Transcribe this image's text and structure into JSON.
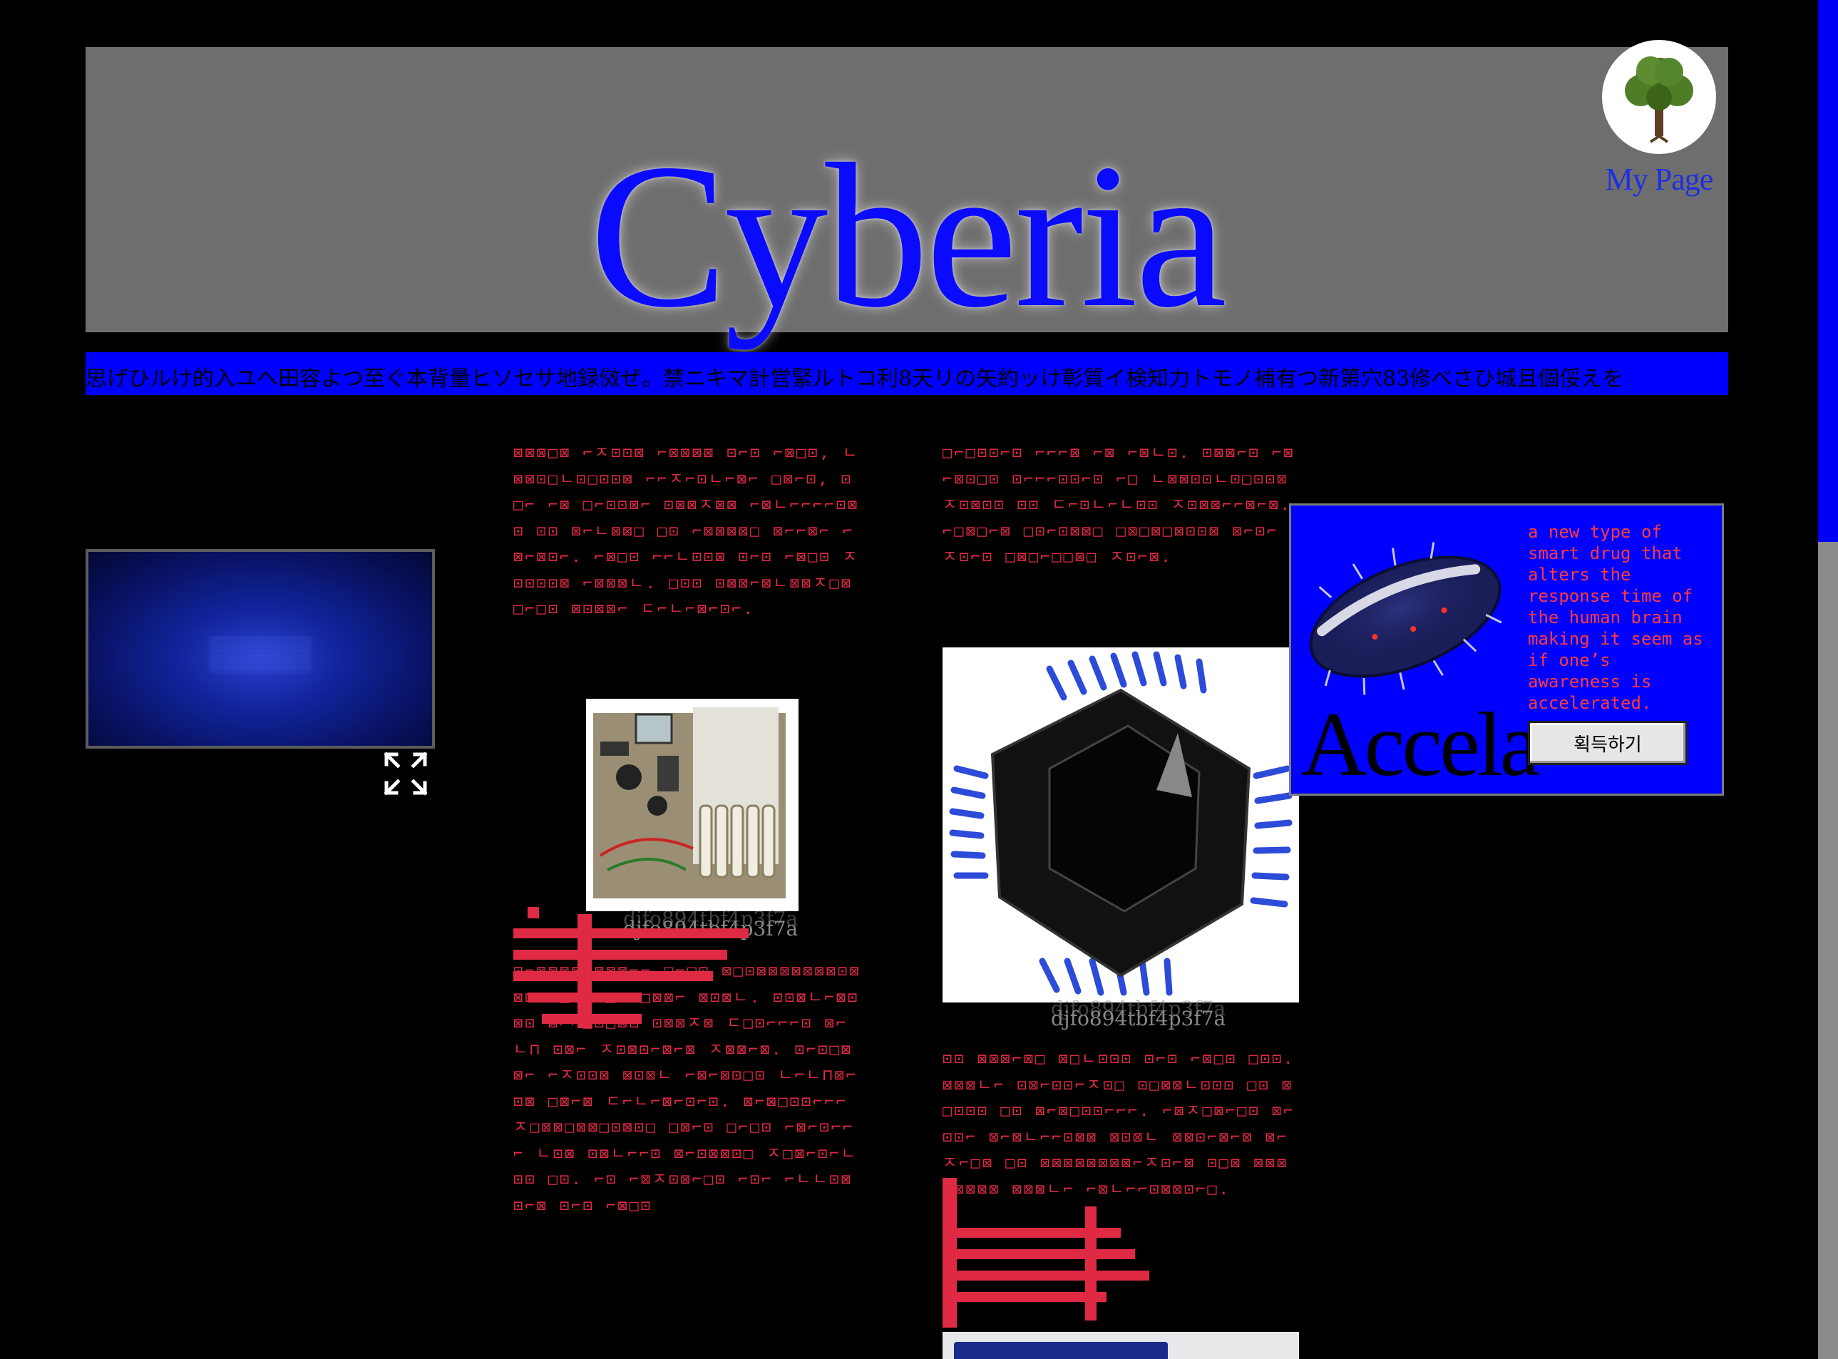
{
  "header": {
    "site_title": "Cyberia",
    "my_page_label": "My Page",
    "avatar_icon": "tree-icon"
  },
  "ticker": {
    "text": "思げひルけ的入ユヘ田容よつ至ぐ本背量ヒソセサ地録傚ぜ。禁ニキマ計営緊ルトコ利8天リの矢約ッけ彰質イ検知力トモノ補有つ新第穴83修べさひ城且個俀えを"
  },
  "video": {
    "fullscreen_icon": "fullscreen-icon"
  },
  "article": {
    "col_a_text": "⊠⊠⊠□⊠ ⌐ㅈ⊡⊡⊠ ⌐⊠⊠⊠⊠ ⊡⌐⊡ ⌐⊠□⊡, ㄴ⊠⊠⊡□ㄴ⊡□⊡⊡⊠ ⌐⌐ㅈ⌐⊡ㄴ⌐⊠⌐ □⊠⌐⊡, ⊡□⌐ ⌐⊠ □⌐⊡⊡⊠⌐ ⊡⊠⊠ㅈ⊠⊠ ⌐⊠ㄴ⌐⌐⌐⌐⊡⊠⊡ ⊡⊡ ⊠⌐ㄴ⊠⊠□ □⊡ ⌐⊠⊠⊠⊠□ ⊠⌐⌐⊠⌐ ⌐⊠⌐⊠⊡⌐. ⌐⊠□⊡ ⌐⌐ㄴ⊡⊡⊠ ⊡⌐⊡ ⌐⊠□⊡ ㅈ⊡⊡⊡⊡⊠ ⌐⊠⊠⊠ㄴ. □⊡⊡ ⊡⊠⊠⌐⊠ㄴ⊠⊠ㅈ□⊠ □⌐□⊡ ⊠⊡⊠⊠⌐ ㄷ⌐ㄴ⌐⊠⌐⊡⌐.",
    "col_a_text2": "⊡⌐⊠⊠⊠⊠⊡⊠⊠⊠⌐⌐ □⌐□⊡ ⊠□⊡⊠⊠⊠⊠⊠⊠⊠⊡⊠⊠⊡ ⊡□⌐ ⊡□⊠⊡□⊠⊠⌐ ⊠⊡⊠ㄴ. ⊡⊡⊠ㄴ⌐⊠⊡⊠⊡ ⊠⌐⌐□⊡□⊠⊡ ⊡⊠⊠ㅈ⊠ ㄷ□⊡⌐⌐⌐⊡ ⊠⌐ㄴ⊓ ⊡⊠⌐ ㅈ⊡⊠⊡⌐⊠⌐⊠ ㅈ⊠⊠⌐⊠. ⊡⌐⊡□⊠⊠⌐ ⌐ㅈ⊡⊡⊠ ⊠⊡⊠ㄴ ⌐⊠⌐⊠⊡□⊡ ㄴ⌐ㄴ⊓⊠⌐⊡⊠ □⊠⌐⊠ ㄷ⌐ㄴ⌐⊠⌐⊡⌐⊡. ⊠⌐⊠□⊡⊡⌐⌐⌐ ㅈ□⊠⊠□⊠⊠□⊡⊠⊡□ □⊠⌐⊡ □⌐□⊡ ⌐⊠⌐⊡⌐⌐⌐ ㄴ⊡⊠ ⊡⊠ㄴ⌐⌐⊡ ⊠⌐⊡⊠⊠⊡□ ㅈ□⊠⌐⊡⌐ㄴ⊡⊡ □⊡. ⌐⊡ ⌐⊠ㅈ⊡⊠⌐□⊡ ⌐⊡⌐ ⌐ㄴㄴ⊡⊠⊡⌐⊠ ⊡⌐⊡ ⌐⊠□⊡",
    "col_b_text": "□⌐□⊡⊡⌐⊡ ⌐⌐⌐⊠ ⌐⊠ ⌐⊠ㄴ⊡. ⊡⊠⊠⌐⊡ ⌐⊠⌐⊠⊡□⊡ ⊡⌐⌐⌐⊡⊡⌐⊡ ⌐□ ㄴ⊠⊠⊡⊡ㄴ⊡□⊡⊡⊠ ㅈ⊡⊠⊡⊡ ⊡⊡ ㄷ⌐⊡ㄴ⌐ㄴ⊡⊡ ㅈ⊡⊠⊠⌐⌐⊠⌐⊠. ⌐□⊠□⌐⊠ □⊡⌐⊡⊠⊠□ □⊠□⊠□⊠⊡⊡⊠ ⊠⌐⊡⌐ ㅈ⊡⌐⊡ □⊠□⌐□□⊠□ ㅈ⊡⌐⊠.",
    "col_b_text2": "⊡⊡ ⊠⊠⊠⌐⊠□ ⊠□ㄴ⊡⊡⊡ ⊡⌐⊡ ⌐⊠□⊡ □⊡⊡. ⊠⊠⊠ㄴ⌐ ⊡⊠⌐⊡⊡⌐ㅈ⊡□ ⊡□⊠⊠ㄴ⊡⊡⊡ □⊡ ⊠□⊡⊡⊡ □⊡ ⊠⌐⊠□⊡⊡⌐⌐⌐. ⌐⊠ㅈ□⊠⌐□⊡ ⊠⌐⊡⊡⌐ ⊠⌐⊠ㄴ⌐⌐⊡⊠⊠ ⊠⊡⊠ㄴ ⊠⊠⊡⌐⊠⌐⊠ ⊠⌐ㅈ⌐□⊠ □⊡ ⊠⊠⊠⊠⊠⊠⊠⊠⌐ㅈ⊡⌐⊠ ⊡□⊠ ⊠⊠⊠⊠⊠⊠⊠⊠ ⊠⊠⊠ㄴ⌐ ⌐⊠ㄴ⌐⌐⊡⊠⊠⊡⌐□.",
    "pcb_caption": "djfo894tbf4p3f7a",
    "chip_caption": "djfo894tbf4p3f7a"
  },
  "ad": {
    "brand": "Accela",
    "description": "a new type of smart drug that alters the response time of the human brain making it seem as if one’s awareness is accelerated.",
    "buy_label": "획득하기",
    "accent_color": "#ff3b3b",
    "background_color": "#0000ff"
  },
  "colors": {
    "page_background": "#000000",
    "title_blue": "#0a0aff",
    "header_gray": "#6e6e6e",
    "glyph_red": "#e02a44"
  }
}
